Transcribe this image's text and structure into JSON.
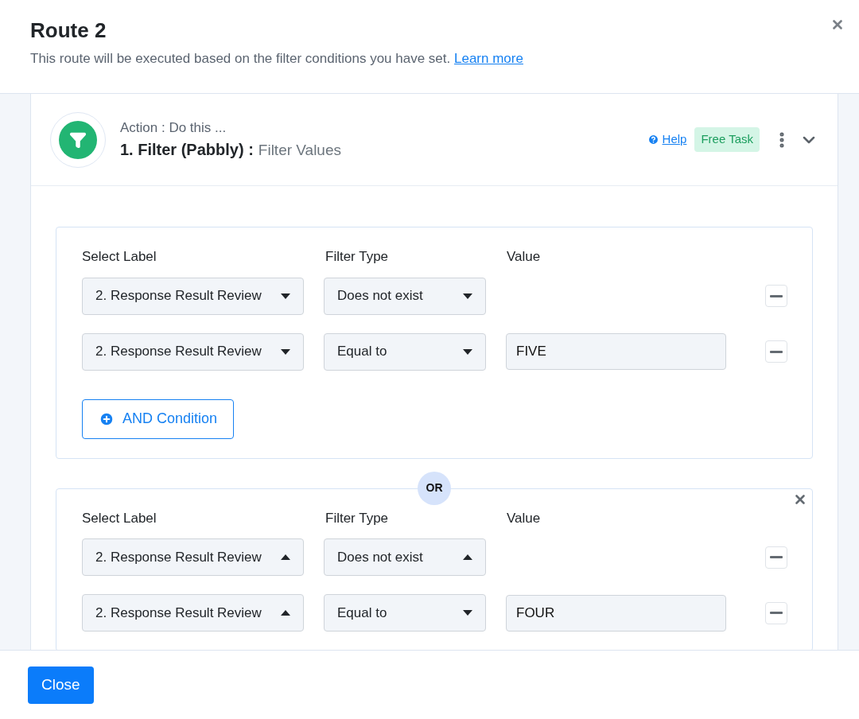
{
  "header": {
    "title": "Route 2",
    "description": "This route will be executed based on the filter conditions you have set.",
    "link": "Learn more"
  },
  "step": {
    "kicker": "Action : Do this ...",
    "title": "1. Filter (Pabbly) :",
    "subtitle": "Filter Values",
    "help": "Help",
    "badge": "Free Task",
    "expanded": true
  },
  "groups": [
    {
      "columns": [
        "Select Label",
        "Filter Type",
        "Value"
      ],
      "rows": [
        {
          "label": {
            "value": "2. Response Result Review",
            "expanded": false
          },
          "filter": {
            "value": "Does not exist",
            "expanded": false
          }
        },
        {
          "label": {
            "value": "2. Response Result Review",
            "expanded": false
          },
          "filter": {
            "value": "Equal to",
            "expanded": false
          },
          "value": "FIVE"
        }
      ],
      "add_button": "AND Condition",
      "removable": false
    },
    {
      "separator": "OR",
      "columns": [
        "Select Label",
        "Filter Type",
        "Value"
      ],
      "rows": [
        {
          "label": {
            "value": "2. Response Result Review",
            "expanded": true
          },
          "filter": {
            "value": "Does not exist",
            "expanded": true
          }
        },
        {
          "label": {
            "value": "2. Response Result Review",
            "expanded": true
          },
          "filter": {
            "value": "Equal to",
            "expanded": false
          },
          "value": "FOUR"
        }
      ],
      "removable": true
    }
  ],
  "footer": {
    "close": "Close"
  }
}
